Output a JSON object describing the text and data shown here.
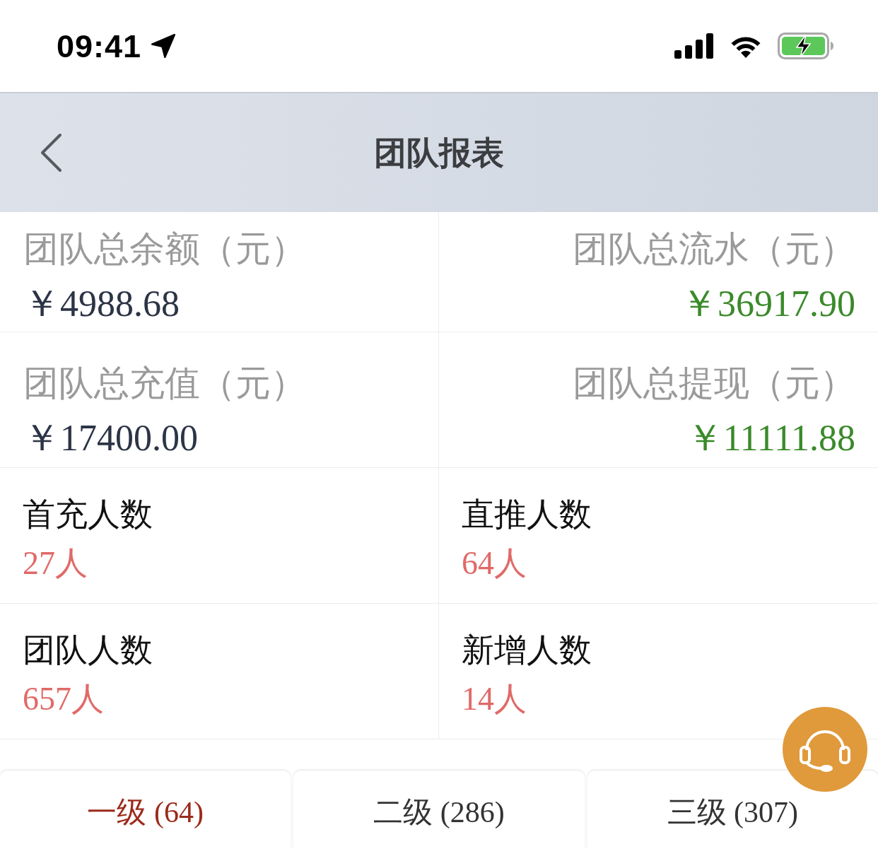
{
  "status_bar": {
    "time": "09:41"
  },
  "nav": {
    "title": "团队报表"
  },
  "totals": [
    {
      "label": "团队总余额（元）",
      "value": "￥4988.68",
      "color": "#2c3446"
    },
    {
      "label": "团队总流水（元）",
      "value": "￥36917.90",
      "color": "#3a8a2a"
    },
    {
      "label": "团队总充值（元）",
      "value": "￥17400.00",
      "color": "#2c3446"
    },
    {
      "label": "团队总提现（元）",
      "value": "￥11111.88",
      "color": "#3a8a2a"
    }
  ],
  "counts": [
    {
      "label": "首充人数",
      "value": "27人"
    },
    {
      "label": "直推人数",
      "value": "64人"
    },
    {
      "label": "团队人数",
      "value": "657人"
    },
    {
      "label": "新增人数",
      "value": "14人"
    }
  ],
  "tabs": [
    {
      "label": "一级 (64)",
      "selected": true
    },
    {
      "label": "二级 (286)",
      "selected": false
    },
    {
      "label": "三级 (307)",
      "selected": false
    }
  ]
}
